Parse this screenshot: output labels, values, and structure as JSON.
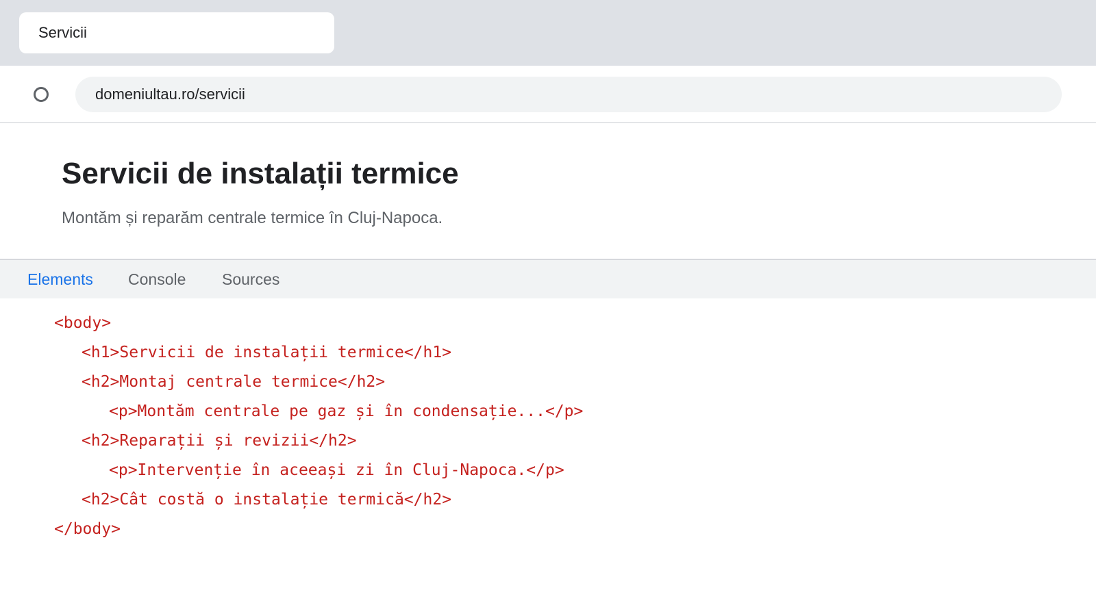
{
  "browser": {
    "tab_title": "Servicii",
    "url": "domeniultau.ro/servicii",
    "reload_icon": "circle-reload-icon"
  },
  "page": {
    "title": "Servicii de instalații termice",
    "subtitle": "Montăm și reparăm centrale termice în Cluj-Napoca."
  },
  "devtools": {
    "tabs": [
      "Elements",
      "Console",
      "Sources"
    ],
    "active_tab": "Elements",
    "active_color": "#1a73e8",
    "code_color": "#c5221f",
    "code_lines": [
      "<body>",
      "<h1>Servicii de instalații termice</h1>",
      "<h2>Montaj centrale termice</h2>",
      "<p>Montăm centrale pe gaz și în condensație...</p>",
      "<h2>Reparații și revizii</h2>",
      "<p>Intervenție în aceeași zi în Cluj-Napoca.</p>",
      "<h2>Cât costă o instalație termică</h2>",
      "</body>"
    ]
  }
}
